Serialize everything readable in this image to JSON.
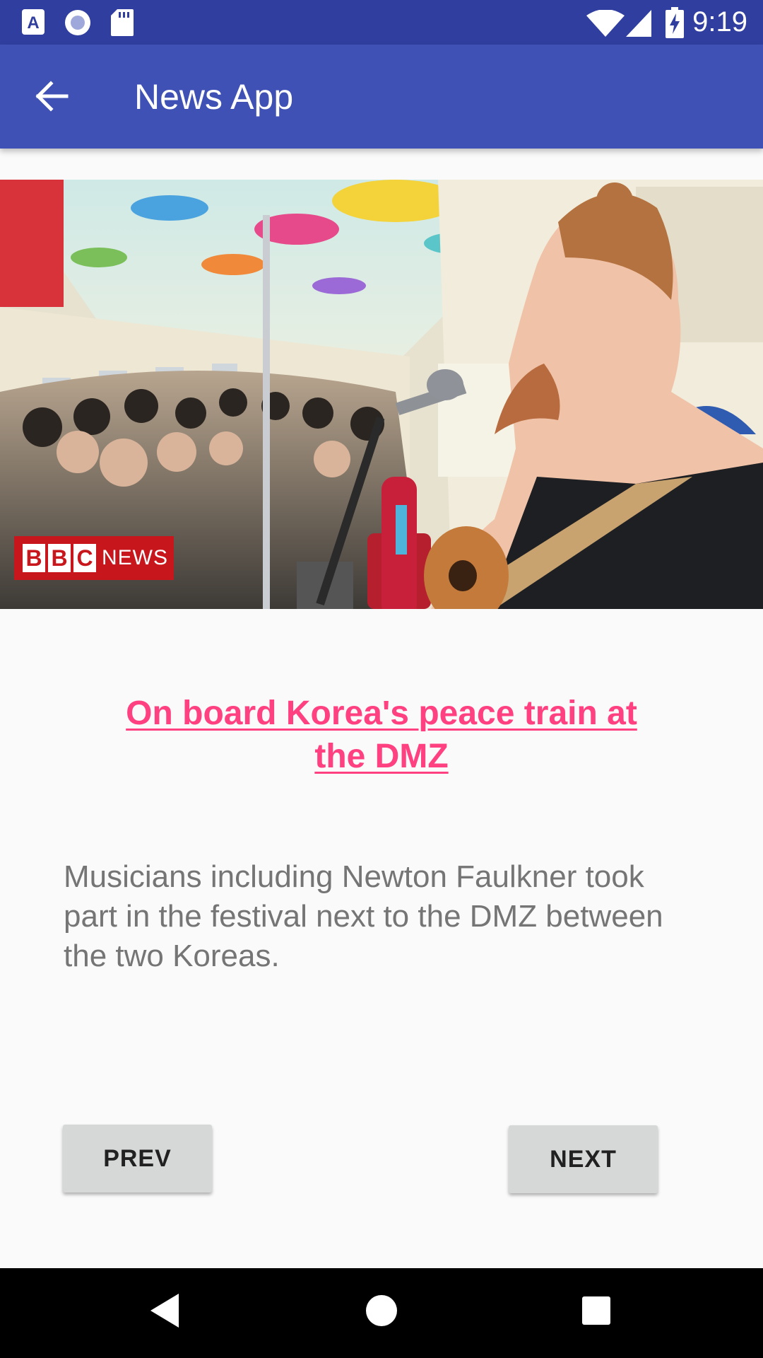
{
  "status_bar": {
    "time": "9:19",
    "left_icons": [
      "keyboard-a-icon",
      "record-icon",
      "sd-card-icon"
    ],
    "right_icons": [
      "wifi-icon",
      "cell-signal-icon",
      "battery-charging-icon"
    ],
    "background": "#303f9f"
  },
  "app_bar": {
    "title": "News App",
    "back_icon": "arrow-back-icon",
    "background": "#3f51b5"
  },
  "article": {
    "image": {
      "description_icon": "news-photo",
      "watermark": "BBC NEWS"
    },
    "title": "On board Korea's peace train at the DMZ",
    "description": "Musicians including Newton Faulkner took part in the festival next to the DMZ between the two Koreas.",
    "title_color": "#ff4081",
    "description_color": "#757575"
  },
  "buttons": {
    "prev_label": "PREV",
    "next_label": "NEXT"
  },
  "nav_bar": {
    "icons": [
      "nav-back-icon",
      "nav-home-icon",
      "nav-recents-icon"
    ]
  }
}
